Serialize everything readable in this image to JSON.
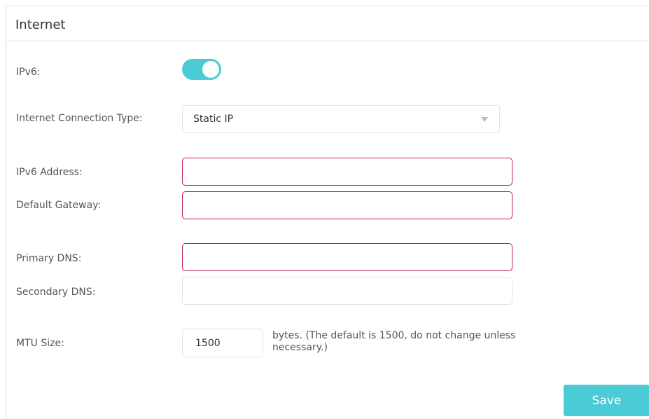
{
  "panel": {
    "title": "Internet"
  },
  "ipv6": {
    "label": "IPv6:",
    "enabled": true,
    "accent_color": "#4acbd6"
  },
  "connection_type": {
    "label": "Internet Connection Type:",
    "selected": "Static IP"
  },
  "fields": {
    "ipv6_address": {
      "label": "IPv6 Address:",
      "value": ""
    },
    "default_gateway": {
      "label": "Default Gateway:",
      "value": ""
    },
    "primary_dns": {
      "label": "Primary DNS:",
      "value": ""
    },
    "secondary_dns": {
      "label": "Secondary DNS:",
      "value": ""
    }
  },
  "mtu": {
    "label": "MTU Size:",
    "value": "1500",
    "hint": "bytes. (The default is 1500, do not change unless necessary.)"
  },
  "actions": {
    "save_label": "Save"
  },
  "colors": {
    "error_border": "#c2185b",
    "button": "#4acbd6"
  }
}
